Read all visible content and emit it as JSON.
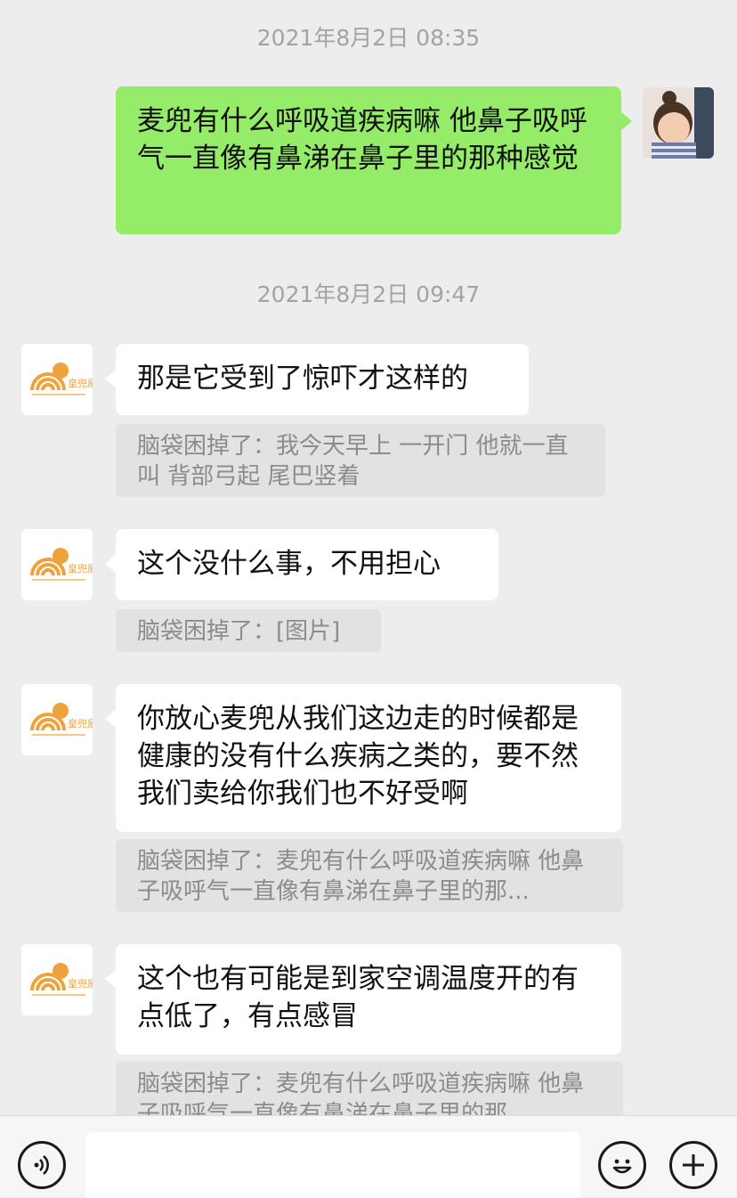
{
  "timestamps": [
    "2021年8月2日 08:35",
    "2021年8月2日 09:47"
  ],
  "messages": [
    {
      "side": "right",
      "text": "麦兜有什么呼吸道疾病嘛 他鼻子吸呼气一直像有鼻涕在鼻子里的那种感觉"
    },
    {
      "side": "left",
      "text": "那是它受到了惊吓才这样的",
      "quote": "脑袋困掉了：我今天早上 一开门 他就一直叫 背部弓起 尾巴竖着"
    },
    {
      "side": "left",
      "text": "这个没什么事，不用担心",
      "quote": "脑袋困掉了：[图片]"
    },
    {
      "side": "left",
      "text": "你放心麦兜从我们这边走的时候都是健康的没有什么疾病之类的，要不然我们卖给你我们也不好受啊",
      "quote": "脑袋困掉了：麦兜有什么呼吸道疾病嘛 他鼻子吸呼气一直像有鼻涕在鼻子里的那..."
    },
    {
      "side": "left",
      "text": "这个也有可能是到家空调温度开的有点低了，有点感冒",
      "quote": "脑袋困掉了：麦兜有什么呼吸道疾病嘛 他鼻子吸呼气一直像有鼻涕在鼻子里的那..."
    }
  ],
  "shop_logo": {
    "brand_text": "皇兜屋",
    "icon": "orange-rainbow-logo"
  },
  "bottom_bar": {
    "voice_icon": "voice-icon",
    "emoji_icon": "emoji-icon",
    "plus_icon": "plus-icon",
    "input_value": ""
  },
  "colors": {
    "background": "#ededed",
    "green_bubble": "#95ec69",
    "white_bubble": "#ffffff",
    "quote_bg": "#e2e2e2",
    "logo_orange": "#f0a23a"
  }
}
